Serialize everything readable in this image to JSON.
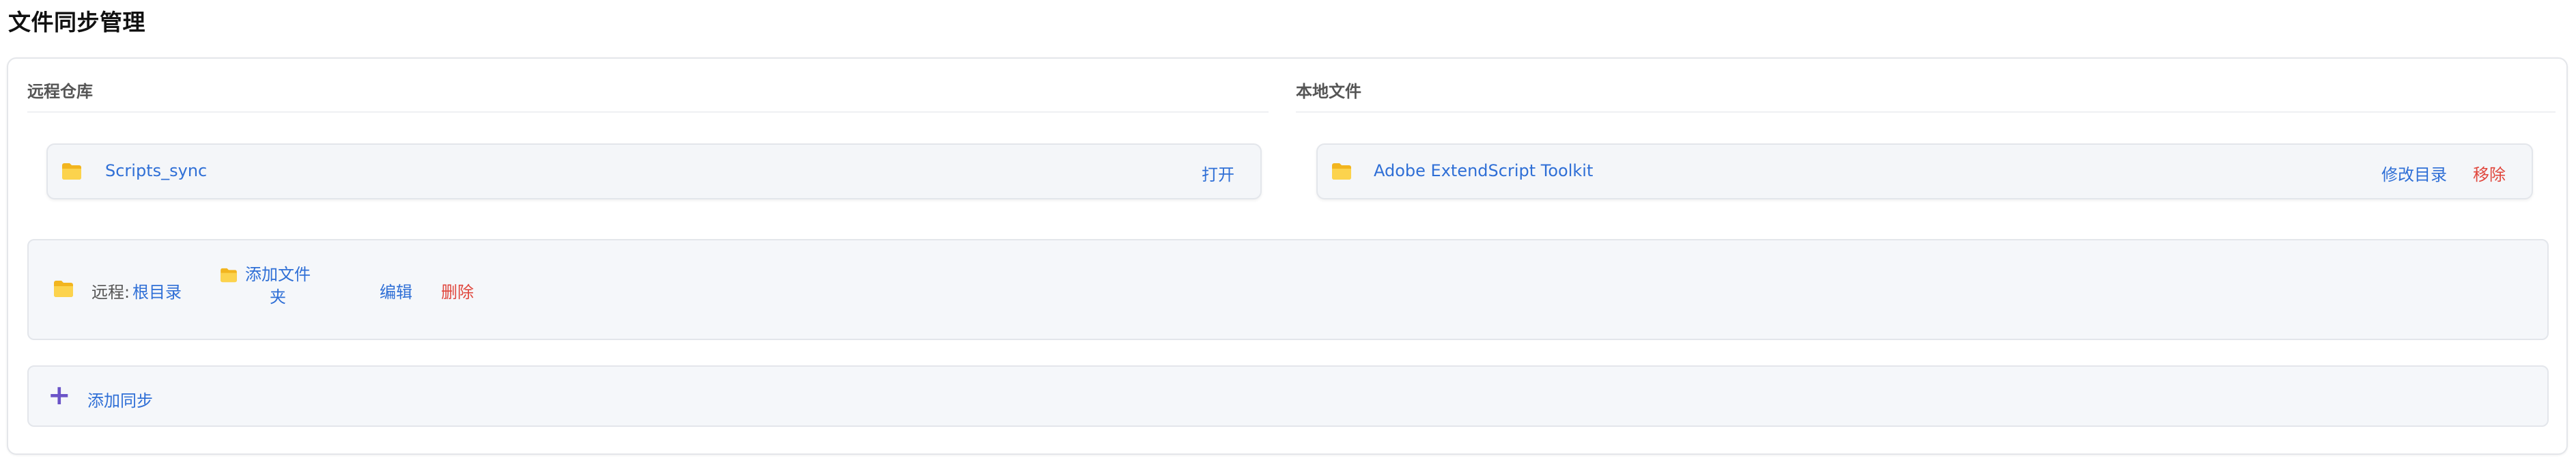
{
  "page": {
    "title": "文件同步管理"
  },
  "remote": {
    "header": "远程仓库",
    "repo_name": "Scripts_sync",
    "open_label": "打开"
  },
  "local": {
    "header": "本地文件",
    "folder_name": "Adobe ExtendScript Toolkit",
    "edit_dir_label": "修改目录",
    "remove_label": "移除"
  },
  "sync_item": {
    "remote_prefix": "远程:",
    "remote_path": "根目录",
    "add_folder_label": "添加文件夹",
    "edit_label": "编辑",
    "delete_label": "删除"
  },
  "add_sync": {
    "label": "添加同步"
  },
  "colors": {
    "link": "#2f6fd6",
    "danger": "#e0473d",
    "folder": "#f5c12e",
    "plus": "#6b54c8"
  },
  "icons": [
    "folder-icon",
    "plus-icon"
  ]
}
